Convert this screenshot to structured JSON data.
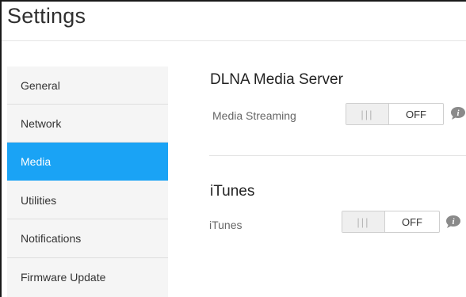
{
  "header": {
    "title": "Settings"
  },
  "sidebar": {
    "items": [
      {
        "label": "General",
        "active": false
      },
      {
        "label": "Network",
        "active": false
      },
      {
        "label": "Media",
        "active": true
      },
      {
        "label": "Utilities",
        "active": false
      },
      {
        "label": "Notifications",
        "active": false
      },
      {
        "label": "Firmware Update",
        "active": false
      }
    ]
  },
  "sections": {
    "dlna": {
      "title": "DLNA Media Server",
      "row_label": "Media Streaming",
      "toggle_state": "OFF",
      "info_icon": "info-icon"
    },
    "itunes": {
      "title": "iTunes",
      "row_label": "iTunes",
      "toggle_state": "OFF",
      "info_icon": "info-icon"
    }
  },
  "toggle_grip": "|||",
  "colors": {
    "accent": "#1aa3f5",
    "sidebar_bg": "#f5f5f5",
    "icon_gray": "#8a8a8a"
  }
}
